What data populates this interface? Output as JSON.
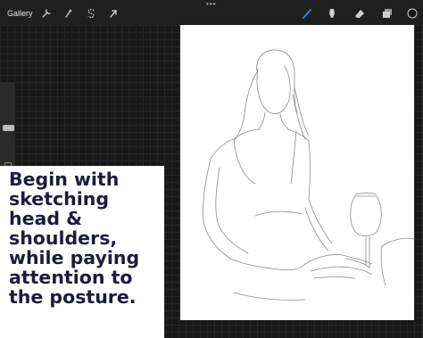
{
  "toolbar": {
    "gallery_label": "Gallery",
    "left_icons": [
      "wrench-icon",
      "magic-wand-icon",
      "selection-s-icon",
      "arrow-transform-icon"
    ],
    "right_icons": [
      "brush-icon",
      "smudge-icon",
      "eraser-icon",
      "layers-icon",
      "color-swatch-icon"
    ],
    "more_label": "•••",
    "accent_color": "#3b82f6"
  },
  "sidebar": {
    "icons": [
      "size-slider",
      "opacity-slider"
    ]
  },
  "caption": {
    "text": "Begin with\nsketching\nhead &\nshoulders,\nwhile paying\nattention to\nthe posture."
  }
}
